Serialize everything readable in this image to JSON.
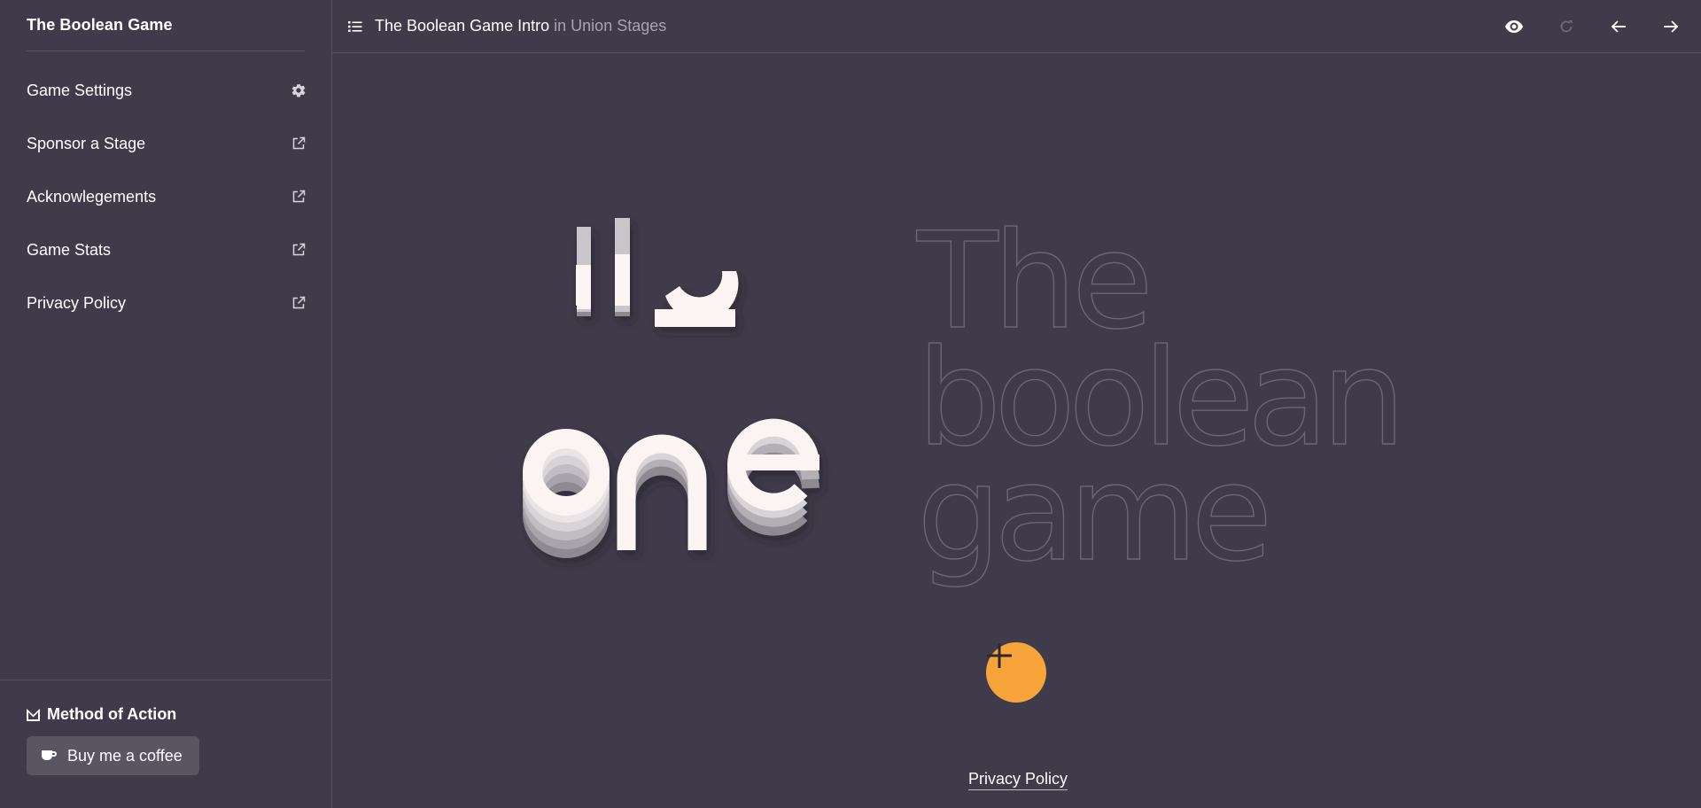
{
  "sidebar": {
    "title": "The Boolean Game",
    "items": [
      {
        "label": "Game Settings",
        "icon": "gear-icon"
      },
      {
        "label": "Sponsor a Stage",
        "icon": "external-link-icon"
      },
      {
        "label": "Acknowlegements",
        "icon": "external-link-icon"
      },
      {
        "label": "Game Stats",
        "icon": "external-link-icon"
      },
      {
        "label": "Privacy Policy",
        "icon": "external-link-icon"
      }
    ],
    "footer": {
      "brand": "Method of Action",
      "brand_icon": "method-of-action-logo",
      "coffee_label": "Buy me a coffee",
      "coffee_icon": "coffee-cup-icon"
    }
  },
  "topbar": {
    "title": "The Boolean Game Intro",
    "separator": "in",
    "section": "Union Stages",
    "icons": [
      "list-icon",
      "eye-icon",
      "refresh-icon",
      "arrow-left-icon",
      "arrow-right-icon"
    ]
  },
  "stage": {
    "shape_word_top": "the",
    "shape_word_bottom": "one",
    "outline_lines": [
      "The",
      "boolean",
      "game"
    ],
    "add_button_icon": "plus-icon",
    "privacy_link": "Privacy Policy"
  },
  "colors": {
    "background": "#3f3b4a",
    "border": "#56515f",
    "accent": "#f7a43a",
    "text": "#ffffff",
    "muted": "#a9a4b1",
    "shape": "#fbf4f2",
    "outline": "#6c6776"
  }
}
